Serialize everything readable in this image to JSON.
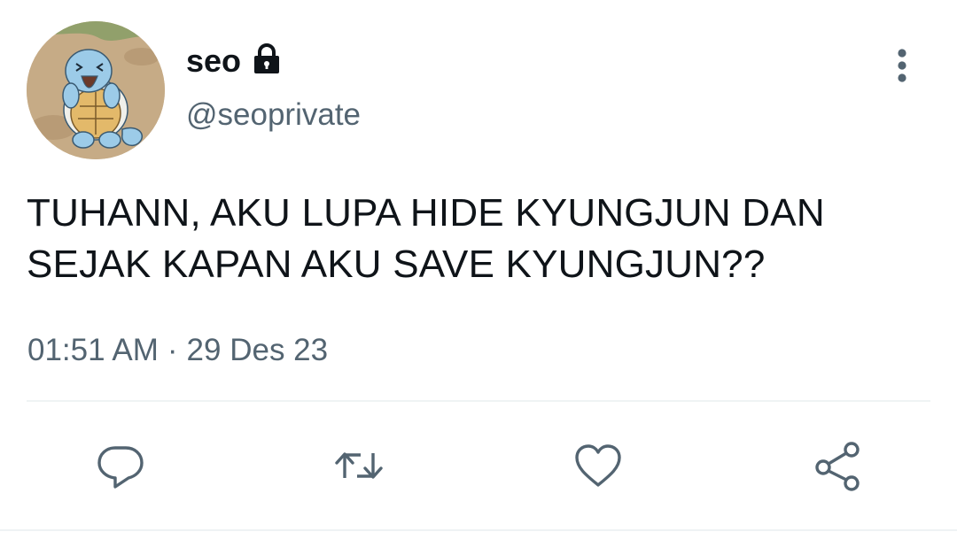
{
  "tweet": {
    "display_name": "seo",
    "handle": "@seoprivate",
    "text": "TUHANN, AKU LUPA HIDE KYUNGJUN DAN\nSEJAK KAPAN AKU SAVE KYUNGJUN??",
    "time": "01:51 AM",
    "separator": "·",
    "date": "29 Des 23",
    "protected_icon": "lock-icon",
    "avatar_icon": "squirtle-avatar"
  },
  "actions": {
    "reply_icon": "reply-icon",
    "retweet_icon": "retweet-icon",
    "like_icon": "heart-icon",
    "share_icon": "share-icon"
  },
  "colors": {
    "text_primary": "#0f1419",
    "text_secondary": "#536471",
    "icon": "#536471",
    "divider": "#eff3f4"
  }
}
